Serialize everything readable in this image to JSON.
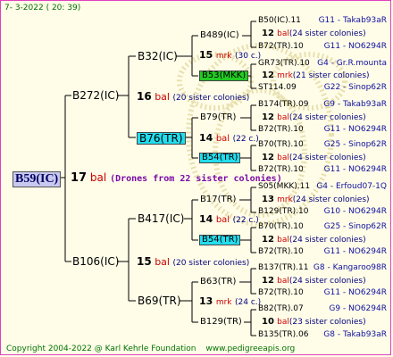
{
  "header": {
    "date": "7-  3-2022 ( 20: 39)"
  },
  "root": {
    "name": "B59(IC)",
    "count": "17",
    "unit": "bal",
    "note": "(Drones from 22 sister colonies)"
  },
  "l1": [
    {
      "name": "B272(IC)",
      "count": "16",
      "unit": "bal",
      "note": "(20 sister colonies)"
    },
    {
      "name": "B106(IC)",
      "count": "15",
      "unit": "bal",
      "note": "(20 sister colonies)"
    }
  ],
  "l2": [
    {
      "name": "B32(IC)",
      "count": "15",
      "unit": "mrk",
      "note": "(30 c.)"
    },
    {
      "name": "B76(TR)",
      "count": "14",
      "unit": "bal",
      "note": "(22 c.)"
    },
    {
      "name": "B417(IC)",
      "count": "14",
      "unit": "bal",
      "note": "(22 c.)"
    },
    {
      "name": "B69(TR)",
      "count": "13",
      "unit": "mrk",
      "note": "(24 c.)"
    }
  ],
  "l3": [
    {
      "name": "B489(IC)"
    },
    {
      "name": "B53(MKK)"
    },
    {
      "name": "B79(TR)"
    },
    {
      "name": "B54(TR)"
    },
    {
      "name": "B17(TR)"
    },
    {
      "name": "B54(TR)"
    },
    {
      "name": "B63(TR)"
    },
    {
      "name": "B129(TR)"
    }
  ],
  "l4": [
    {
      "type": "line",
      "name": "B50(IC).11",
      "tag": "G11 - Takab93aR"
    },
    {
      "type": "note",
      "count": "12",
      "unit": "bal",
      "note": "(24 sister colonies)"
    },
    {
      "type": "line",
      "name": "B72(TR).10",
      "tag": "G11 - NO6294R"
    },
    {
      "type": "line",
      "name": "GR73(TR).10",
      "tag": "G4 - Gr.R.mounta"
    },
    {
      "type": "note",
      "count": "12",
      "unit": "mrk",
      "note": "(21 sister colonies)"
    },
    {
      "type": "line",
      "name": "ST114.09",
      "tag": "G22 - Sinop62R"
    },
    {
      "type": "line",
      "name": "B174(TR).09",
      "tag": "G9 - Takab93aR"
    },
    {
      "type": "note",
      "count": "12",
      "unit": "bal",
      "note": "(24 sister colonies)"
    },
    {
      "type": "line",
      "name": "B72(TR).10",
      "tag": "G11 - NO6294R"
    },
    {
      "type": "line",
      "name": "B70(TR).10",
      "tag": "G25 - Sinop62R"
    },
    {
      "type": "note",
      "count": "12",
      "unit": "bal",
      "note": "(24 sister colonies)"
    },
    {
      "type": "line",
      "name": "B72(TR).10",
      "tag": "G11 - NO6294R"
    },
    {
      "type": "line",
      "name": "S05(MKK).11",
      "tag": "G4 - Erfoud07-1Q"
    },
    {
      "type": "note",
      "count": "13",
      "unit": "mrk",
      "note": "(24 sister colonies)"
    },
    {
      "type": "line",
      "name": "B129(TR).10",
      "tag": "G10 - NO6294R"
    },
    {
      "type": "line",
      "name": "B70(TR).10",
      "tag": "G25 - Sinop62R"
    },
    {
      "type": "note",
      "count": "12",
      "unit": "bal",
      "note": "(24 sister colonies)"
    },
    {
      "type": "line",
      "name": "B72(TR).10",
      "tag": "G11 - NO6294R"
    },
    {
      "type": "line",
      "name": "B137(TR).11",
      "tag": "G8 - Kangaroo98R"
    },
    {
      "type": "note",
      "count": "12",
      "unit": "bal",
      "note": "(24 sister colonies)"
    },
    {
      "type": "line",
      "name": "B72(TR).10",
      "tag": "G11 - NO6294R"
    },
    {
      "type": "line",
      "name": "B82(TR).07",
      "tag": "G9 - NO6294R"
    },
    {
      "type": "note",
      "count": "10",
      "unit": "bal",
      "note": "(23 sister colonies)"
    },
    {
      "type": "line",
      "name": "B135(TR).06",
      "tag": "G8 - Takab93aR"
    }
  ],
  "footer": {
    "copyright": "Copyright 2004-2022 @ Karl Kehrle Foundation",
    "site": "www.pedigreeapis.org"
  }
}
